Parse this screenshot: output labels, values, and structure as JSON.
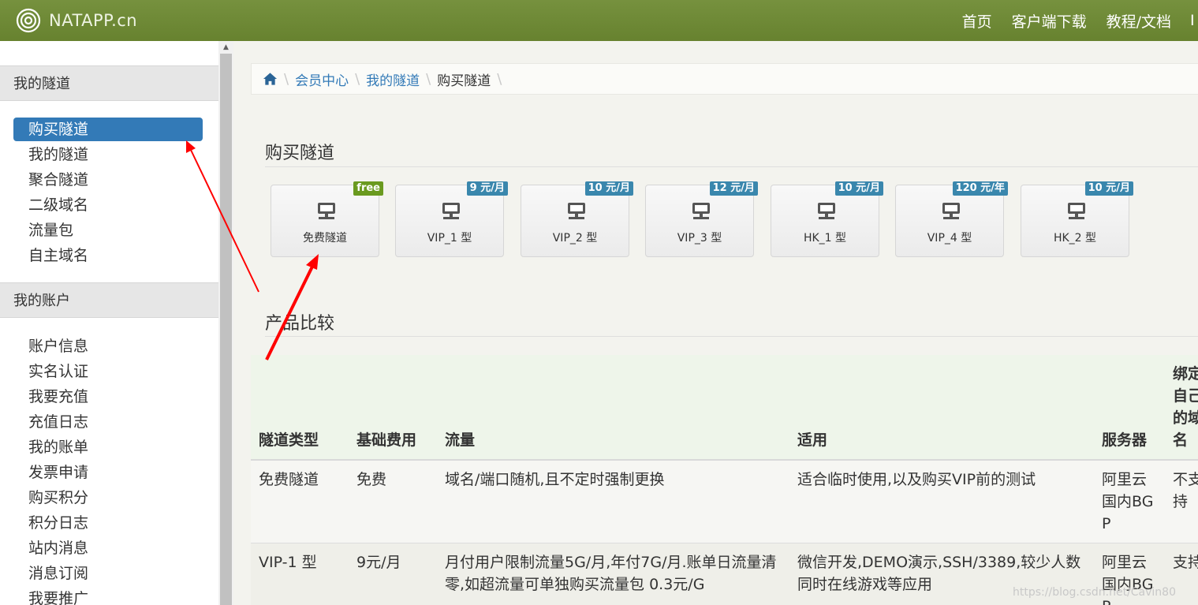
{
  "navbar": {
    "brand": "NATAPP.cn",
    "links": [
      "首页",
      "客户端下载",
      "教程/文档",
      "I"
    ]
  },
  "sidebar": {
    "sections": [
      {
        "title": "我的隧道",
        "items": [
          "购买隧道",
          "我的隧道",
          "聚合隧道",
          "二级域名",
          "流量包",
          "自主域名"
        ]
      },
      {
        "title": "我的账户",
        "items": [
          "账户信息",
          "实名认证",
          "我要充值",
          "充值日志",
          "我的账单",
          "发票申请",
          "购买积分",
          "积分日志",
          "站内消息",
          "消息订阅",
          "我要推广"
        ]
      }
    ],
    "active_item": "购买隧道"
  },
  "breadcrumb": [
    "会员中心",
    "我的隧道",
    "购买隧道"
  ],
  "buy_section": {
    "title": "购买隧道",
    "plans": [
      {
        "label": "免费隧道",
        "badge": "free",
        "badge_color": "#6a9a1f"
      },
      {
        "label": "VIP_1 型",
        "badge": "9 元/月",
        "badge_color": "#3a87ad"
      },
      {
        "label": "VIP_2 型",
        "badge": "10 元/月",
        "badge_color": "#3a87ad"
      },
      {
        "label": "VIP_3 型",
        "badge": "12 元/月",
        "badge_color": "#3a87ad"
      },
      {
        "label": "HK_1 型",
        "badge": "10 元/月",
        "badge_color": "#3a87ad"
      },
      {
        "label": "VIP_4 型",
        "badge": "120 元/年",
        "badge_color": "#3a87ad"
      },
      {
        "label": "HK_2 型",
        "badge": "10 元/月",
        "badge_color": "#3a87ad"
      }
    ]
  },
  "compare_section": {
    "title": "产品比较",
    "headers": [
      "隧道类型",
      "基础费用",
      "流量",
      "适用",
      "服务器",
      "绑定自己的域名"
    ],
    "rows": [
      [
        "免费隧道",
        "免费",
        "域名/端口随机,且不定时强制更换",
        "适合临时使用,以及购买VIP前的测试",
        "阿里云国内BGP",
        "不支持"
      ],
      [
        "VIP-1 型",
        "9元/月",
        "月付用户限制流量5G/月,年付7G/月.账单日流量清零,如超流量可单独购买流量包 0.3元/G",
        "微信开发,DEMO演示,SSH/3389,较少人数同时在线游戏等应用",
        "阿里云国内BGP",
        "支持"
      ]
    ]
  },
  "watermark": "https://blog.csdn.net/Cavin80",
  "colors": {
    "navbar": "#6d8a37",
    "active": "#337ab7",
    "badge_blue": "#3a87ad",
    "badge_green": "#6a9a1f",
    "arrow": "#ff0000"
  }
}
